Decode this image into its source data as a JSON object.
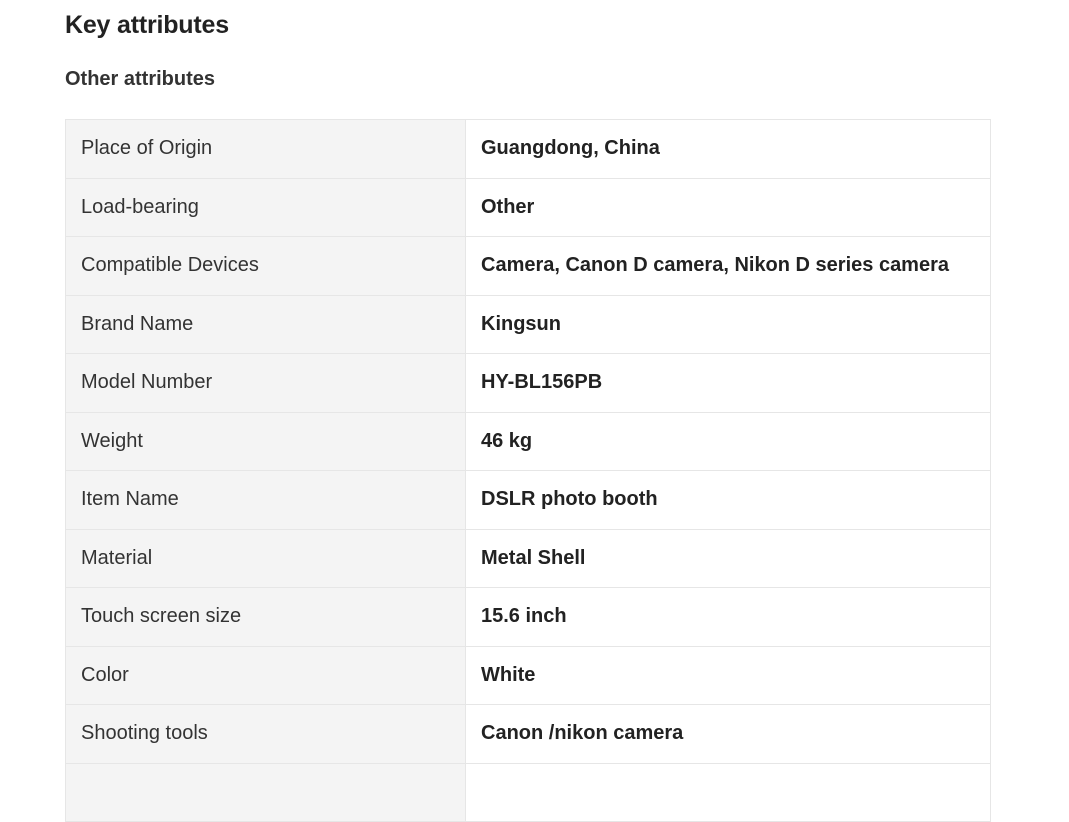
{
  "section": {
    "title": "Key attributes",
    "subtitle": "Other attributes"
  },
  "attributes": [
    {
      "key": "Place of Origin",
      "value": "Guangdong, China"
    },
    {
      "key": "Load-bearing",
      "value": "Other"
    },
    {
      "key": "Compatible Devices",
      "value": "Camera, Canon D camera, Nikon D series camera"
    },
    {
      "key": "Brand Name",
      "value": "Kingsun"
    },
    {
      "key": "Model Number",
      "value": "HY-BL156PB"
    },
    {
      "key": "Weight",
      "value": "46 kg"
    },
    {
      "key": "Item Name",
      "value": "DSLR photo booth"
    },
    {
      "key": "Material",
      "value": "Metal Shell"
    },
    {
      "key": "Touch screen size",
      "value": "15.6 inch"
    },
    {
      "key": "Color",
      "value": "White"
    },
    {
      "key": "Shooting tools",
      "value": "Canon /nikon camera"
    },
    {
      "key": "",
      "value": ""
    }
  ]
}
